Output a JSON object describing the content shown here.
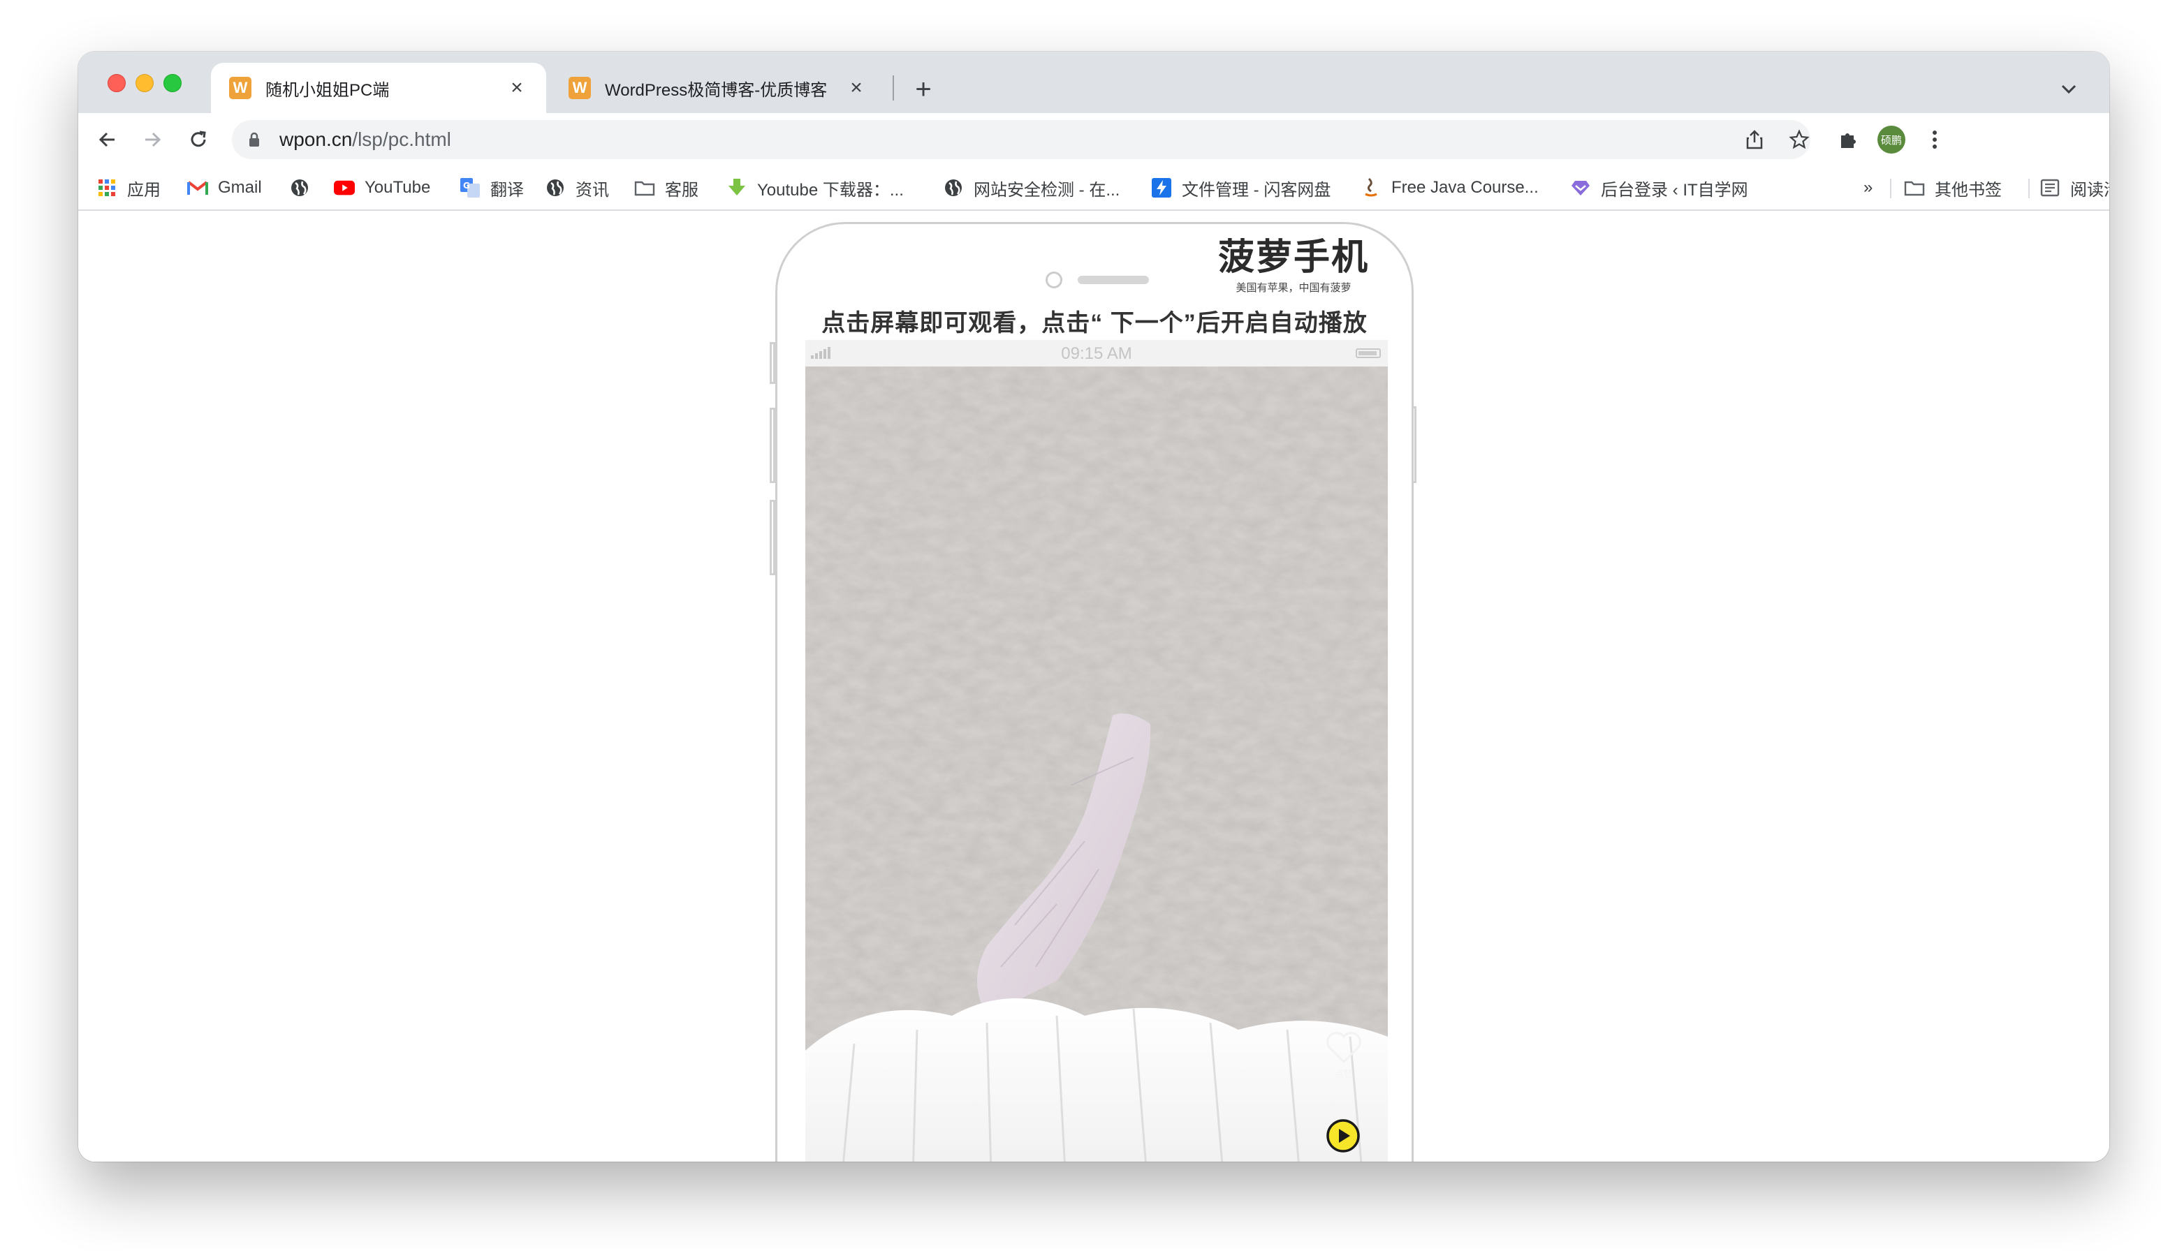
{
  "browser": {
    "tabs": [
      {
        "title": "随机小姐姐PC端",
        "favicon": "W",
        "active": true
      },
      {
        "title": "WordPress极简博客-优质博客",
        "favicon": "W",
        "active": false
      }
    ],
    "address": {
      "host": "wpon.cn",
      "path": "/lsp/pc.html"
    },
    "profile_initials": "硕鹏",
    "bookmarks": [
      {
        "label": "应用",
        "icon": "apps-grid-icon"
      },
      {
        "label": "Gmail",
        "icon": "gmail-icon"
      },
      {
        "label": "",
        "icon": "globe-icon"
      },
      {
        "label": "YouTube",
        "icon": "youtube-icon"
      },
      {
        "label": "翻译",
        "icon": "translate-icon"
      },
      {
        "label": "资讯",
        "icon": "globe-icon"
      },
      {
        "label": "客服",
        "icon": "folder-icon"
      },
      {
        "label": "Youtube 下载器：...",
        "icon": "download-icon"
      },
      {
        "label": "网站安全检测 - 在...",
        "icon": "globe-icon"
      },
      {
        "label": "文件管理 - 闪客网盘",
        "icon": "lightning-icon"
      },
      {
        "label": "Free Java Course...",
        "icon": "java-icon"
      },
      {
        "label": "后台登录 ‹ IT自学网",
        "icon": "heart-gem-icon"
      }
    ],
    "overflow_label": "»",
    "other_bookmarks": "其他书签",
    "reading_list": "阅读清单"
  },
  "page": {
    "brand_name": "菠萝手机",
    "brand_slogan": "美国有苹果，中国有菠萝",
    "hint": "点击屏幕即可观看，点击“ 下一个”后开启自动播放",
    "status_time": "09:15 AM",
    "like_label": "点赞"
  },
  "colors": {
    "tabstrip": "#dee1e6",
    "favicon": "#f0a23a",
    "play_button": "#f7e52a",
    "avatar": "#5a8a3c"
  }
}
